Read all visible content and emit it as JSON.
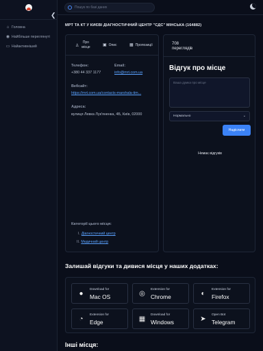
{
  "sidebar": {
    "items": [
      {
        "label": "Головна",
        "icon": "home-icon"
      },
      {
        "label": "Найбільше переглянуті",
        "icon": "eye-icon"
      },
      {
        "label": "Найактивніший",
        "icon": "chat-icon"
      }
    ]
  },
  "search": {
    "placeholder": "Пошук по базі даних"
  },
  "page": {
    "title": "МРТ ТА КТ У КИЄВІ ДІАГНОСТИЧНИЙ ЦЕНТР \"СДС\" МІНСЬКА (164882)"
  },
  "tabs": [
    {
      "label": "Про місце",
      "icon": "info-icon"
    },
    {
      "label": "Опис",
      "icon": "doc-icon"
    },
    {
      "label": "Пропозиції",
      "icon": "grid-icon"
    }
  ],
  "contact": {
    "phone_label": "Телефон:",
    "phone": "+380 44 337 1177",
    "email_label": "Email:",
    "email": "info@mrt.com.ua",
    "website_label": "Вебсайт:",
    "website": "https://mrt.com.ua/contacts-marshala-tim...",
    "address_label": "Адреса:",
    "address": "вулиця Левка Лук'яненка, 4Б, Київ, 02000"
  },
  "categories": {
    "title": "Категорії цього місця:",
    "items": [
      {
        "num": "I.",
        "label": "Діагностичний центр"
      },
      {
        "num": "II.",
        "label": "Медичний центр"
      }
    ]
  },
  "stats": {
    "views": "708",
    "views_label": "переглядів"
  },
  "review": {
    "title": "Відгук про місце",
    "placeholder": "Ваша думка про місце",
    "rating": "Нормально",
    "submit": "Надіслати",
    "empty": "Немає відгуків"
  },
  "apps": {
    "title": "Залишай відгуки та дивися місця у наших додатках:",
    "items": [
      {
        "line1": "Download for",
        "line2": "Mac OS",
        "icon": "apple-icon"
      },
      {
        "line1": "Extension for",
        "line2": "Chrome",
        "icon": "chrome-icon"
      },
      {
        "line1": "Extension for",
        "line2": "Firefox",
        "icon": "firefox-icon"
      },
      {
        "line1": "Extension for",
        "line2": "Edge",
        "icon": "edge-icon"
      },
      {
        "line1": "Download for",
        "line2": "Windows",
        "icon": "windows-icon"
      },
      {
        "line1": "Open Bot",
        "line2": "Telegram",
        "icon": "telegram-icon"
      }
    ]
  },
  "more": {
    "title": "Інші місця:"
  }
}
